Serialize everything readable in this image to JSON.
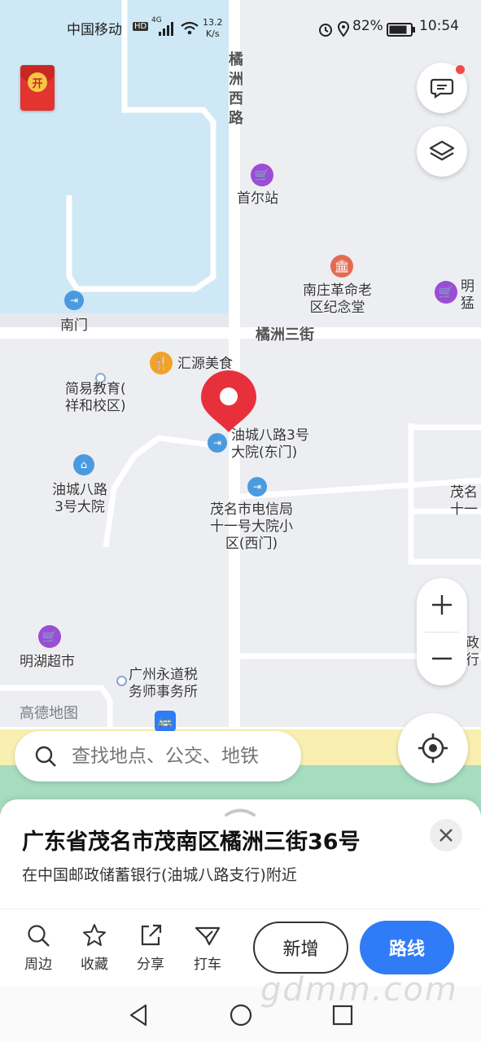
{
  "status_bar": {
    "carrier": "中国移动",
    "hd": "HD",
    "network": "4G",
    "speed_value": "13.2",
    "speed_unit": "K/s",
    "battery": "82%",
    "time": "10:54"
  },
  "map": {
    "roads": {
      "vertical": "橘\n洲\n西\n路",
      "horizontal": "橘洲三街"
    },
    "pois": [
      {
        "label": "首尔站",
        "icon": "shopping-cart-icon",
        "color": "#9b4dd6"
      },
      {
        "label": "南庄革命老\n区纪念堂",
        "icon": "monument-icon",
        "color": "#e46a53"
      },
      {
        "label": "明\n猛",
        "icon": "shopping-cart-icon",
        "color": "#9b4dd6"
      },
      {
        "label": "南门",
        "icon": "entrance-icon",
        "color": "#4a9ae0"
      },
      {
        "label": "汇源美食",
        "icon": "food-icon",
        "color": "#f2a227"
      },
      {
        "label": "简易教育(\n祥和校区)",
        "icon": "dot-icon",
        "color": "#8aa7d3"
      },
      {
        "label": "油城八路3号\n大院(东门)",
        "icon": "entrance-icon",
        "color": "#4a9ae0"
      },
      {
        "label": "油城八路\n3号大院",
        "icon": "residence-icon",
        "color": "#4a9ae0"
      },
      {
        "label": "茂名市电信局\n十一号大院小\n区(西门)",
        "icon": "entrance-icon",
        "color": "#4a9ae0"
      },
      {
        "label": "茂名\n十一",
        "icon": "none",
        "color": "#333333"
      },
      {
        "label": "明湖超市",
        "icon": "shopping-cart-icon",
        "color": "#9b4dd6"
      },
      {
        "label": "广州永道税\n务师事务所",
        "icon": "dot-icon",
        "color": "#8aa7d3"
      },
      {
        "label": "政\n行",
        "icon": "none",
        "color": "#333333"
      }
    ],
    "watermark": "高德地图"
  },
  "search": {
    "placeholder": "查找地点、公交、地铁"
  },
  "sheet": {
    "address": "广东省茂名市茂南区橘洲三街36号",
    "nearby": "在中国邮政储蓄银行(油城八路支行)附近",
    "actions": [
      {
        "label": "周边",
        "icon": "search-icon"
      },
      {
        "label": "收藏",
        "icon": "star-icon"
      },
      {
        "label": "分享",
        "icon": "share-icon"
      },
      {
        "label": "打车",
        "icon": "taxi-icon"
      }
    ],
    "add_button": "新增",
    "route_button": "路线"
  },
  "site_watermark": "gdmm.com",
  "red_packet_label": "开",
  "colors": {
    "accent": "#2f7cf6",
    "pin": "#e8303c",
    "water": "#cfe8f6",
    "green_strip": "#a6dcc0"
  }
}
